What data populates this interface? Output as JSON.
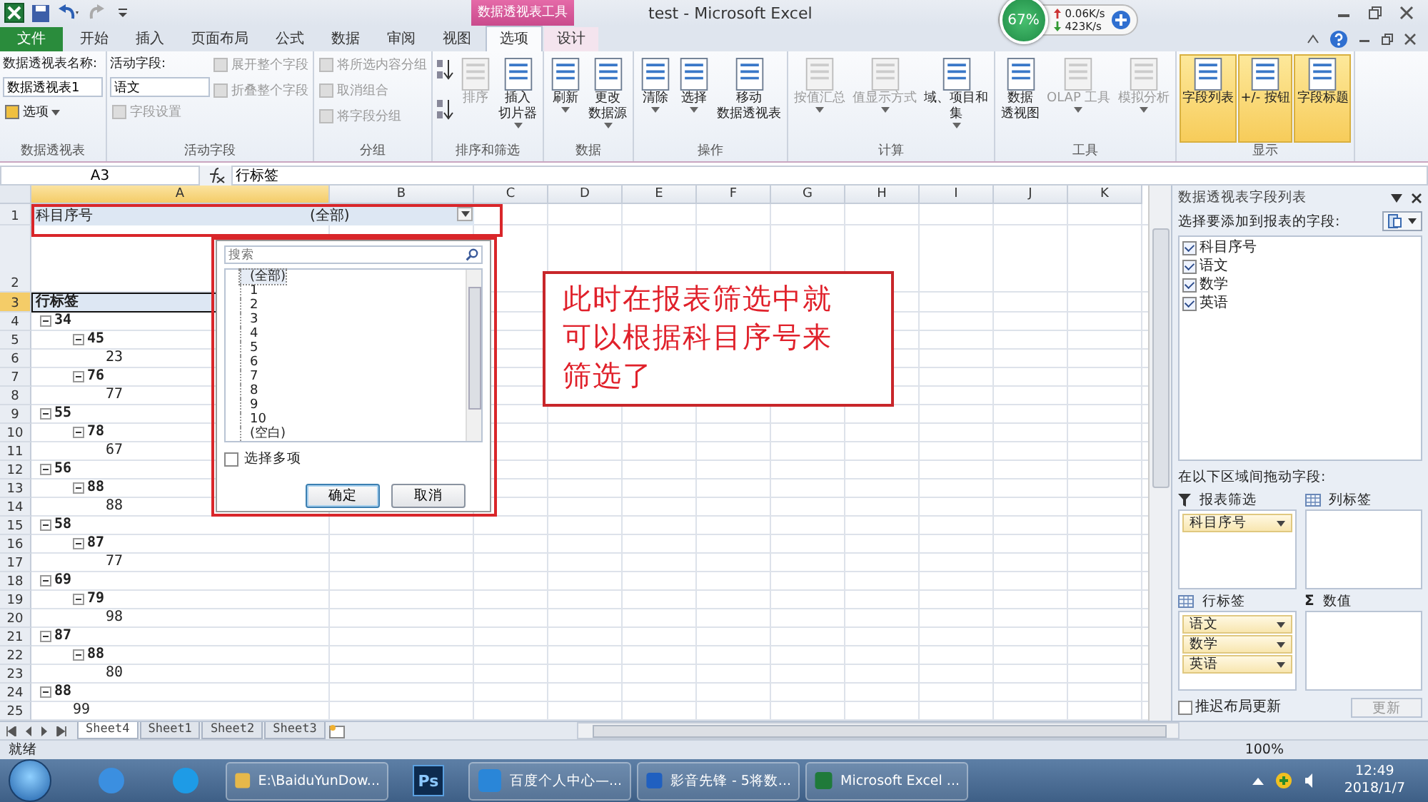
{
  "title_bar": {
    "contextual_header": "数据透视表工具",
    "title": "test - Microsoft Excel",
    "net_widget": {
      "percent": "67%",
      "upload": "0.06K/s",
      "download": "423K/s"
    }
  },
  "tabs": [
    {
      "label": "文件",
      "kind": "file",
      "selected": false,
      "contextual": false
    },
    {
      "label": "开始",
      "kind": "normal",
      "selected": false,
      "contextual": false
    },
    {
      "label": "插入",
      "kind": "normal",
      "selected": false,
      "contextual": false
    },
    {
      "label": "页面布局",
      "kind": "normal",
      "selected": false,
      "contextual": false
    },
    {
      "label": "公式",
      "kind": "normal",
      "selected": false,
      "contextual": false
    },
    {
      "label": "数据",
      "kind": "normal",
      "selected": false,
      "contextual": false
    },
    {
      "label": "审阅",
      "kind": "normal",
      "selected": false,
      "contextual": false
    },
    {
      "label": "视图",
      "kind": "normal",
      "selected": false,
      "contextual": false
    },
    {
      "label": "选项",
      "kind": "normal",
      "selected": true,
      "contextual": true
    },
    {
      "label": "设计",
      "kind": "normal",
      "selected": false,
      "contextual": true
    }
  ],
  "ribbon": {
    "groups": [
      {
        "label": "数据透视表",
        "columns": [
          [
            {
              "kind": "label",
              "label": "数据透视表名称:"
            },
            {
              "kind": "input",
              "value": "数据透视表1"
            },
            {
              "kind": "small",
              "label": "选项",
              "dropdown": true,
              "disabled": false
            }
          ]
        ]
      },
      {
        "label": "活动字段",
        "columns": [
          [
            {
              "kind": "label",
              "label": "活动字段:"
            },
            {
              "kind": "input",
              "value": "语文"
            },
            {
              "kind": "small",
              "label": "字段设置",
              "dropdown": false,
              "disabled": true
            }
          ],
          [
            {
              "kind": "small",
              "label": "展开整个字段",
              "dropdown": false,
              "disabled": true
            },
            {
              "kind": "small",
              "label": "折叠整个字段",
              "dropdown": false,
              "disabled": true
            }
          ]
        ]
      },
      {
        "label": "分组",
        "columns": [
          [
            {
              "kind": "small",
              "label": "将所选内容分组",
              "dropdown": false,
              "disabled": true
            },
            {
              "kind": "small",
              "label": "取消组合",
              "dropdown": false,
              "disabled": true
            },
            {
              "kind": "small",
              "label": "将字段分组",
              "dropdown": false,
              "disabled": true
            }
          ]
        ]
      },
      {
        "label": "排序和筛选",
        "columns": [
          [
            {
              "kind": "icon",
              "disabled": false
            },
            {
              "kind": "icon",
              "disabled": false
            }
          ],
          [
            {
              "kind": "large",
              "label": [
                "排序"
              ],
              "dropdown": false,
              "disabled": true
            }
          ],
          [
            {
              "kind": "large",
              "label": [
                "插入",
                "切片器"
              ],
              "dropdown": true,
              "disabled": false
            }
          ]
        ]
      },
      {
        "label": "数据",
        "columns": [
          [
            {
              "kind": "large",
              "label": [
                "刷新"
              ],
              "dropdown": true,
              "disabled": false
            }
          ],
          [
            {
              "kind": "large",
              "label": [
                "更改",
                "数据源"
              ],
              "dropdown": true,
              "disabled": false
            }
          ]
        ]
      },
      {
        "label": "操作",
        "columns": [
          [
            {
              "kind": "large",
              "label": [
                "清除"
              ],
              "dropdown": true,
              "disabled": false
            }
          ],
          [
            {
              "kind": "large",
              "label": [
                "选择"
              ],
              "dropdown": true,
              "disabled": false
            }
          ],
          [
            {
              "kind": "large",
              "label": [
                "移动",
                "数据透视表"
              ],
              "dropdown": false,
              "disabled": false
            }
          ]
        ]
      },
      {
        "label": "计算",
        "columns": [
          [
            {
              "kind": "large",
              "label": [
                "按值汇总"
              ],
              "dropdown": true,
              "disabled": true
            }
          ],
          [
            {
              "kind": "large",
              "label": [
                "值显示方式"
              ],
              "dropdown": true,
              "disabled": true
            }
          ],
          [
            {
              "kind": "large",
              "label": [
                "域、项目和",
                "集"
              ],
              "dropdown": true,
              "disabled": false
            }
          ]
        ]
      },
      {
        "label": "工具",
        "columns": [
          [
            {
              "kind": "large",
              "label": [
                "数据",
                "透视图"
              ],
              "dropdown": false,
              "disabled": false
            }
          ],
          [
            {
              "kind": "large",
              "label": [
                "OLAP 工具"
              ],
              "dropdown": true,
              "disabled": true
            }
          ],
          [
            {
              "kind": "large",
              "label": [
                "模拟分析"
              ],
              "dropdown": true,
              "disabled": true
            }
          ]
        ]
      },
      {
        "label": "显示",
        "columns": [
          [
            {
              "kind": "large",
              "label": [
                "字段列表"
              ],
              "dropdown": false,
              "disabled": false,
              "on": true
            }
          ],
          [
            {
              "kind": "large",
              "label": [
                "+/- 按钮"
              ],
              "dropdown": false,
              "disabled": false,
              "on": true
            }
          ],
          [
            {
              "kind": "large",
              "label": [
                "字段标题"
              ],
              "dropdown": false,
              "disabled": false,
              "on": true
            }
          ]
        ]
      }
    ]
  },
  "formula_bar": {
    "name_box": "A3",
    "formula": "行标签"
  },
  "grid": {
    "columns": [
      {
        "label": "A",
        "selected": true
      },
      {
        "label": "B",
        "selected": false
      },
      {
        "label": "C",
        "selected": false
      },
      {
        "label": "D",
        "selected": false
      },
      {
        "label": "E",
        "selected": false
      },
      {
        "label": "F",
        "selected": false
      },
      {
        "label": "G",
        "selected": false
      },
      {
        "label": "H",
        "selected": false
      },
      {
        "label": "I",
        "selected": false
      },
      {
        "label": "J",
        "selected": false
      },
      {
        "label": "K",
        "selected": false
      }
    ],
    "row_numbers": [
      {
        "label": "1",
        "selected": false
      },
      {
        "label": "2",
        "selected": false
      },
      {
        "label": "3",
        "selected": true
      },
      {
        "label": "4",
        "selected": false
      },
      {
        "label": "5",
        "selected": false
      },
      {
        "label": "6",
        "selected": false
      },
      {
        "label": "7",
        "selected": false
      },
      {
        "label": "8",
        "selected": false
      },
      {
        "label": "9",
        "selected": false
      },
      {
        "label": "10",
        "selected": false
      },
      {
        "label": "11",
        "selected": false
      },
      {
        "label": "12",
        "selected": false
      },
      {
        "label": "13",
        "selected": false
      },
      {
        "label": "14",
        "selected": false
      },
      {
        "label": "15",
        "selected": false
      },
      {
        "label": "16",
        "selected": false
      },
      {
        "label": "17",
        "selected": false
      },
      {
        "label": "18",
        "selected": false
      },
      {
        "label": "19",
        "selected": false
      },
      {
        "label": "20",
        "selected": false
      },
      {
        "label": "21",
        "selected": false
      },
      {
        "label": "22",
        "selected": false
      },
      {
        "label": "23",
        "selected": false
      },
      {
        "label": "24",
        "selected": false
      },
      {
        "label": "25",
        "selected": false
      }
    ],
    "filter": {
      "field": "科目序号",
      "value": "(全部)"
    },
    "row_header": "行标签",
    "tree": [
      {
        "label": "34",
        "children": [
          {
            "label": "45",
            "children": [
              {
                "label": "23"
              }
            ]
          },
          {
            "label": "76",
            "children": [
              {
                "label": "77"
              }
            ]
          }
        ]
      },
      {
        "label": "55",
        "children": [
          {
            "label": "78",
            "children": [
              {
                "label": "67"
              }
            ]
          }
        ]
      },
      {
        "label": "56",
        "children": [
          {
            "label": "88",
            "children": [
              {
                "label": "88"
              }
            ]
          }
        ]
      },
      {
        "label": "58",
        "children": [
          {
            "label": "87",
            "children": [
              {
                "label": "77"
              }
            ]
          }
        ]
      },
      {
        "label": "69",
        "children": [
          {
            "label": "79",
            "children": [
              {
                "label": "98"
              }
            ]
          }
        ]
      },
      {
        "label": "87",
        "children": [
          {
            "label": "88",
            "children": [
              {
                "label": "80"
              }
            ]
          }
        ]
      },
      {
        "label": "88",
        "children": [
          {
            "label": "99"
          }
        ]
      }
    ]
  },
  "popup": {
    "search_placeholder": "搜索",
    "items": [
      {
        "label": "(全部)",
        "selected": true
      },
      {
        "label": "1",
        "selected": false
      },
      {
        "label": "2",
        "selected": false
      },
      {
        "label": "3",
        "selected": false
      },
      {
        "label": "4",
        "selected": false
      },
      {
        "label": "5",
        "selected": false
      },
      {
        "label": "6",
        "selected": false
      },
      {
        "label": "7",
        "selected": false
      },
      {
        "label": "8",
        "selected": false
      },
      {
        "label": "9",
        "selected": false
      },
      {
        "label": "10",
        "selected": false
      },
      {
        "label": "(空白)",
        "selected": false
      }
    ],
    "multi_select": {
      "label": "选择多项",
      "checked": false
    },
    "buttons": [
      {
        "label": "确定",
        "kind": "default"
      },
      {
        "label": "取消",
        "kind": "normal"
      }
    ]
  },
  "callout": {
    "text": "此时在报表筛选中就可以根据科目序号来筛选了"
  },
  "panel": {
    "title": "数据透视表字段列表",
    "choose_label": "选择要添加到报表的字段:",
    "fields": [
      {
        "label": "科目序号",
        "checked": true
      },
      {
        "label": "语文",
        "checked": true
      },
      {
        "label": "数学",
        "checked": true
      },
      {
        "label": "英语",
        "checked": true
      }
    ],
    "drag_label": "在以下区域间拖动字段:",
    "areas": [
      {
        "kind": "filter",
        "label": "报表筛选",
        "items": [
          "科目序号"
        ]
      },
      {
        "kind": "columns",
        "label": "列标签"
      },
      {
        "kind": "rows",
        "label": "行标签",
        "items": [
          "语文",
          "数学",
          "英语"
        ]
      },
      {
        "kind": "values",
        "label": "数值",
        "symbol": "Σ"
      }
    ],
    "defer": {
      "label": "推迟布局更新",
      "checked": false
    },
    "update_button": {
      "label": "更新",
      "disabled": true
    }
  },
  "sheet_tabs": [
    {
      "label": "Sheet4",
      "selected": true
    },
    {
      "label": "Sheet1",
      "selected": false
    },
    {
      "label": "Sheet2",
      "selected": false
    },
    {
      "label": "Sheet3",
      "selected": false
    }
  ],
  "status_bar": {
    "text": "就绪",
    "zoom": "100%"
  },
  "taskbar": {
    "items": [
      {
        "kind": "pinned",
        "color": "#3b8fe0"
      },
      {
        "kind": "pinned",
        "color": "#1e9be6"
      },
      {
        "kind": "window",
        "label": "E:\\BaiduYunDow...",
        "color": "#e6b84a"
      },
      {
        "kind": "badge",
        "label": "Ps",
        "color": "#0d2b4f"
      },
      {
        "kind": "window",
        "label": "百度个人中心—...",
        "color": "#2a86d8"
      },
      {
        "kind": "window",
        "label": "影音先锋 - 5将数...",
        "color": "#2060c0"
      },
      {
        "kind": "window",
        "label": "Microsoft Excel ...",
        "color": "#1f7a3a"
      }
    ],
    "time": "12:49",
    "date": "2018/1/7"
  }
}
